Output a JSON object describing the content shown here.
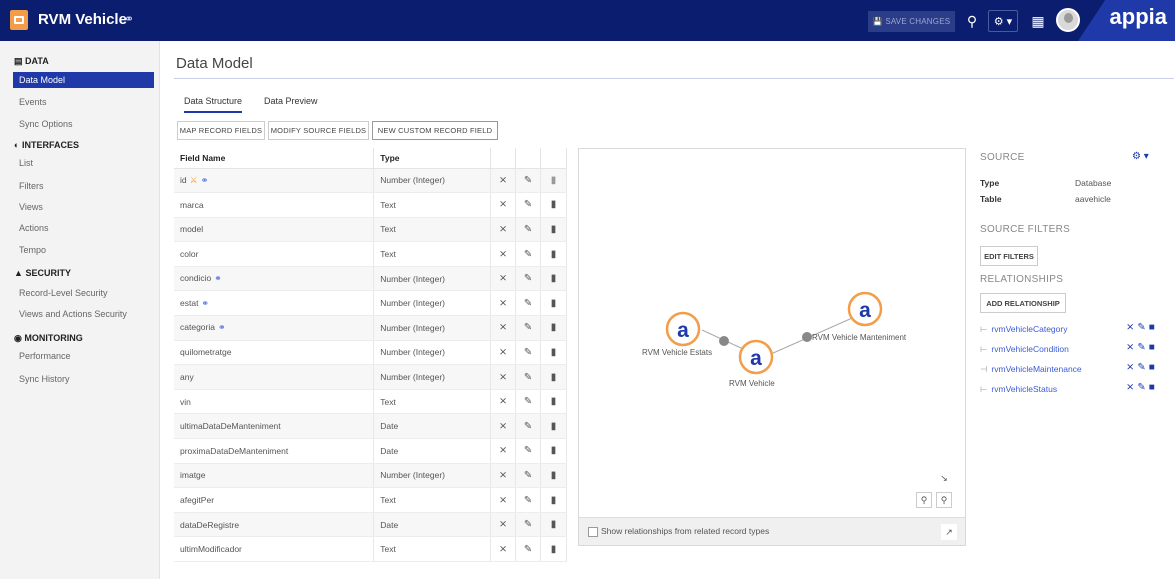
{
  "app": {
    "title": "RVM Vehicle",
    "save_label": "SAVE CHANGES",
    "brand": "appia"
  },
  "sidebar": {
    "sections": [
      {
        "label": "DATA",
        "icon": "database-icon"
      },
      {
        "label": "INTERFACES",
        "icon": "interfaces-icon"
      },
      {
        "label": "SECURITY",
        "icon": "lock-icon"
      },
      {
        "label": "MONITORING",
        "icon": "monitoring-icon"
      }
    ],
    "items": [
      {
        "label": "Data Model"
      },
      {
        "label": "Events"
      },
      {
        "label": "Sync Options"
      },
      {
        "label": "List"
      },
      {
        "label": "Filters"
      },
      {
        "label": "Views"
      },
      {
        "label": "Actions"
      },
      {
        "label": "Tempo"
      },
      {
        "label": "Record-Level Security"
      },
      {
        "label": "Views and Actions Security"
      },
      {
        "label": "Performance"
      },
      {
        "label": "Sync History"
      }
    ]
  },
  "main": {
    "title": "Data Model",
    "tabs": [
      {
        "label": "Data Structure"
      },
      {
        "label": "Data Preview"
      }
    ],
    "toolbar": [
      "MAP RECORD FIELDS",
      "MODIFY SOURCE FIELDS",
      "NEW CUSTOM RECORD FIELD"
    ],
    "columns": [
      "Field Name",
      "Type"
    ],
    "rows": [
      {
        "name": "id",
        "type": "Number (Integer)"
      },
      {
        "name": "marca",
        "type": "Text"
      },
      {
        "name": "model",
        "type": "Text"
      },
      {
        "name": "color",
        "type": "Text"
      },
      {
        "name": "condicio",
        "type": "Number (Integer)"
      },
      {
        "name": "estat",
        "type": "Number (Integer)"
      },
      {
        "name": "categoria",
        "type": "Number (Integer)"
      },
      {
        "name": "quilometratge",
        "type": "Number (Integer)"
      },
      {
        "name": "any",
        "type": "Number (Integer)"
      },
      {
        "name": "vin",
        "type": "Text"
      },
      {
        "name": "ultimaDataDeManteniment",
        "type": "Date"
      },
      {
        "name": "proximaDataDeManteniment",
        "type": "Date"
      },
      {
        "name": "imatge",
        "type": "Number (Integer)"
      },
      {
        "name": "afegitPer",
        "type": "Text"
      },
      {
        "name": "dataDeRegistre",
        "type": "Date"
      },
      {
        "name": "ultimModificador",
        "type": "Text"
      }
    ]
  },
  "graph": {
    "nodes": [
      "RVM Vehicle Estats",
      "RVM Vehicle",
      "RVM Vehicle Manteniment"
    ],
    "show_related_label": "Show relationships from related record types"
  },
  "source": {
    "heading": "SOURCE",
    "type_label": "Type",
    "type_value": "Database",
    "table_label": "Table",
    "table_value": "aavehicle",
    "filters_heading": "SOURCE FILTERS",
    "edit_filters": "EDIT FILTERS",
    "relationships_heading": "RELATIONSHIPS",
    "add_relationship": "ADD RELATIONSHIP",
    "relationships": [
      "rvmVehicleCategory",
      "rvmVehicleCondition",
      "rvmVehicleMaintenance",
      "rvmVehicleStatus"
    ]
  },
  "colors": {
    "topbar": "#0a1d6e",
    "accent": "#1f3aa8",
    "node": "#f39c4a"
  }
}
